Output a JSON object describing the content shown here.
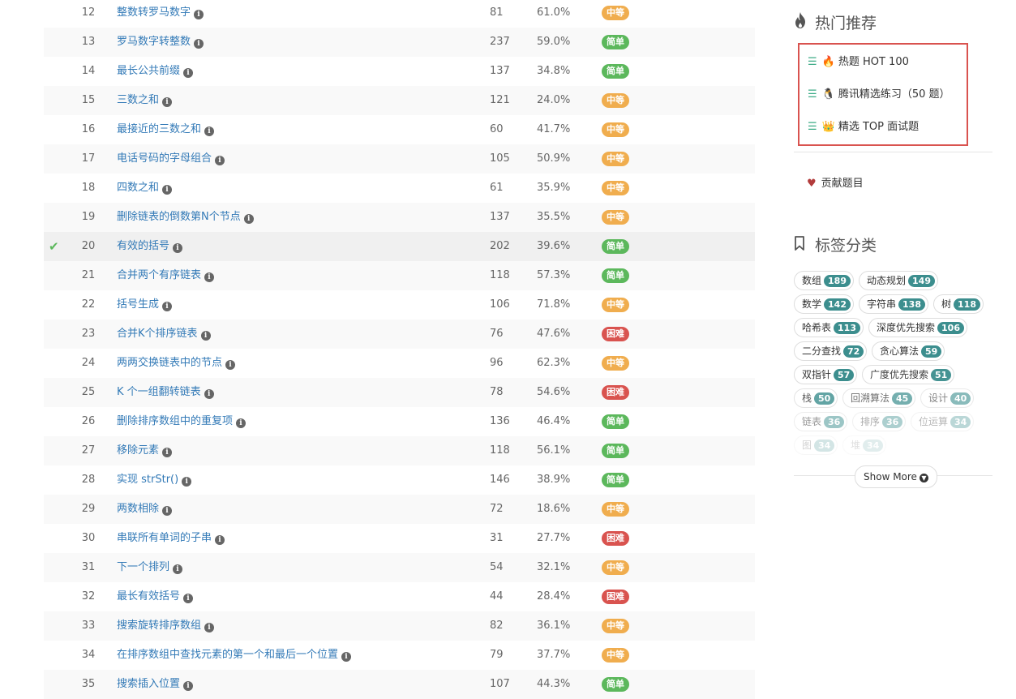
{
  "problems": [
    {
      "id": "12",
      "title": "整数转罗马数字",
      "solutions": "81",
      "rate": "61.0%",
      "difficulty": "中等",
      "level": "medium",
      "solved": false
    },
    {
      "id": "13",
      "title": "罗马数字转整数",
      "solutions": "237",
      "rate": "59.0%",
      "difficulty": "简单",
      "level": "easy",
      "solved": false
    },
    {
      "id": "14",
      "title": "最长公共前缀",
      "solutions": "137",
      "rate": "34.8%",
      "difficulty": "简单",
      "level": "easy",
      "solved": false
    },
    {
      "id": "15",
      "title": "三数之和",
      "solutions": "121",
      "rate": "24.0%",
      "difficulty": "中等",
      "level": "medium",
      "solved": false
    },
    {
      "id": "16",
      "title": "最接近的三数之和",
      "solutions": "60",
      "rate": "41.7%",
      "difficulty": "中等",
      "level": "medium",
      "solved": false
    },
    {
      "id": "17",
      "title": "电话号码的字母组合",
      "solutions": "105",
      "rate": "50.9%",
      "difficulty": "中等",
      "level": "medium",
      "solved": false
    },
    {
      "id": "18",
      "title": "四数之和",
      "solutions": "61",
      "rate": "35.9%",
      "difficulty": "中等",
      "level": "medium",
      "solved": false
    },
    {
      "id": "19",
      "title": "删除链表的倒数第N个节点",
      "solutions": "137",
      "rate": "35.5%",
      "difficulty": "中等",
      "level": "medium",
      "solved": false
    },
    {
      "id": "20",
      "title": "有效的括号",
      "solutions": "202",
      "rate": "39.6%",
      "difficulty": "简单",
      "level": "easy",
      "solved": true
    },
    {
      "id": "21",
      "title": "合并两个有序链表",
      "solutions": "118",
      "rate": "57.3%",
      "difficulty": "简单",
      "level": "easy",
      "solved": false
    },
    {
      "id": "22",
      "title": "括号生成",
      "solutions": "106",
      "rate": "71.8%",
      "difficulty": "中等",
      "level": "medium",
      "solved": false
    },
    {
      "id": "23",
      "title": "合并K个排序链表",
      "solutions": "76",
      "rate": "47.6%",
      "difficulty": "困难",
      "level": "hard",
      "solved": false
    },
    {
      "id": "24",
      "title": "两两交换链表中的节点",
      "solutions": "96",
      "rate": "62.3%",
      "difficulty": "中等",
      "level": "medium",
      "solved": false
    },
    {
      "id": "25",
      "title": "K 个一组翻转链表",
      "solutions": "78",
      "rate": "54.6%",
      "difficulty": "困难",
      "level": "hard",
      "solved": false
    },
    {
      "id": "26",
      "title": "删除排序数组中的重复项",
      "solutions": "136",
      "rate": "46.4%",
      "difficulty": "简单",
      "level": "easy",
      "solved": false
    },
    {
      "id": "27",
      "title": "移除元素",
      "solutions": "118",
      "rate": "56.1%",
      "difficulty": "简单",
      "level": "easy",
      "solved": false
    },
    {
      "id": "28",
      "title": "实现 strStr()",
      "solutions": "146",
      "rate": "38.9%",
      "difficulty": "简单",
      "level": "easy",
      "solved": false
    },
    {
      "id": "29",
      "title": "两数相除",
      "solutions": "72",
      "rate": "18.6%",
      "difficulty": "中等",
      "level": "medium",
      "solved": false
    },
    {
      "id": "30",
      "title": "串联所有单词的子串",
      "solutions": "31",
      "rate": "27.7%",
      "difficulty": "困难",
      "level": "hard",
      "solved": false
    },
    {
      "id": "31",
      "title": "下一个排列",
      "solutions": "54",
      "rate": "32.1%",
      "difficulty": "中等",
      "level": "medium",
      "solved": false
    },
    {
      "id": "32",
      "title": "最长有效括号",
      "solutions": "44",
      "rate": "28.4%",
      "difficulty": "困难",
      "level": "hard",
      "solved": false
    },
    {
      "id": "33",
      "title": "搜索旋转排序数组",
      "solutions": "82",
      "rate": "36.1%",
      "difficulty": "中等",
      "level": "medium",
      "solved": false
    },
    {
      "id": "34",
      "title": "在排序数组中查找元素的第一个和最后一个位置",
      "solutions": "79",
      "rate": "37.7%",
      "difficulty": "中等",
      "level": "medium",
      "solved": false
    },
    {
      "id": "35",
      "title": "搜索插入位置",
      "solutions": "107",
      "rate": "44.3%",
      "difficulty": "简单",
      "level": "easy",
      "solved": false
    }
  ],
  "sidebar": {
    "hot_title": "热门推荐",
    "hot_icon": "flame-icon",
    "hot_lists": [
      {
        "icon": "fire-emoji",
        "emoji": "🔥",
        "label": "热题 HOT 100"
      },
      {
        "icon": "penguin-emoji",
        "emoji": "🐧",
        "label": "腾讯精选练习（50 题）"
      },
      {
        "icon": "crown-emoji",
        "emoji": "👑",
        "label": "精选 TOP 面试题"
      }
    ],
    "contribute": "贡献题目",
    "tags_title": "标签分类",
    "tags_icon": "bookmark-icon",
    "tags": [
      {
        "name": "数组",
        "count": "189",
        "opacity": 1.0
      },
      {
        "name": "动态规划",
        "count": "149",
        "opacity": 1.0
      },
      {
        "name": "数学",
        "count": "142",
        "opacity": 1.0
      },
      {
        "name": "字符串",
        "count": "138",
        "opacity": 1.0
      },
      {
        "name": "树",
        "count": "118",
        "opacity": 1.0
      },
      {
        "name": "哈希表",
        "count": "113",
        "opacity": 1.0
      },
      {
        "name": "深度优先搜索",
        "count": "106",
        "opacity": 1.0
      },
      {
        "name": "二分查找",
        "count": "72",
        "opacity": 1.0
      },
      {
        "name": "贪心算法",
        "count": "59",
        "opacity": 1.0
      },
      {
        "name": "双指针",
        "count": "57",
        "opacity": 1.0
      },
      {
        "name": "广度优先搜索",
        "count": "51",
        "opacity": 0.95
      },
      {
        "name": "栈",
        "count": "50",
        "opacity": 0.8
      },
      {
        "name": "回溯算法",
        "count": "45",
        "opacity": 0.7
      },
      {
        "name": "设计",
        "count": "40",
        "opacity": 0.6
      },
      {
        "name": "链表",
        "count": "36",
        "opacity": 0.5
      },
      {
        "name": "排序",
        "count": "36",
        "opacity": 0.42
      },
      {
        "name": "位运算",
        "count": "34",
        "opacity": 0.35
      },
      {
        "name": "图",
        "count": "34",
        "opacity": 0.22
      },
      {
        "name": "堆",
        "count": "34",
        "opacity": 0.15
      }
    ],
    "show_more": "Show More"
  },
  "colors": {
    "easy": "#5cb85c",
    "medium": "#f0ad4e",
    "hard": "#d9534f",
    "link": "#337ab7",
    "tag_count": "#3c8e8e",
    "highlight_border": "#d9534f"
  }
}
